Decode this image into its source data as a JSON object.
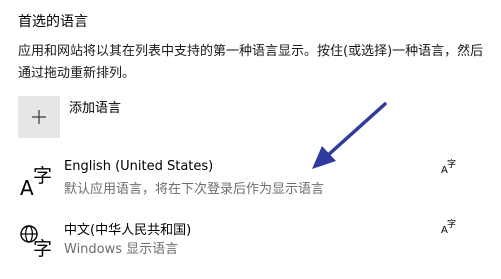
{
  "section": {
    "title": "首选的语言",
    "description": "应用和网站将以其在列表中支持的第一种语言显示。按住(或选择)一种语言，然后通过拖动重新排列。"
  },
  "add_language": {
    "label": "添加语言",
    "icon": "plus-icon"
  },
  "languages": [
    {
      "name": "English (United States)",
      "subtitle": "默认应用语言，将在下次登录后作为显示语言",
      "glyph": "A字",
      "icon": "language-icon",
      "feature_icon": "display-language-icon"
    },
    {
      "name": "中文(中华人民共和国)",
      "subtitle": "Windows 显示语言",
      "glyph": "字",
      "icon": "globe-language-icon",
      "feature_icon": "display-language-icon"
    }
  ],
  "annotation": {
    "color": "#2f3b9e",
    "icon": "arrow-icon"
  }
}
